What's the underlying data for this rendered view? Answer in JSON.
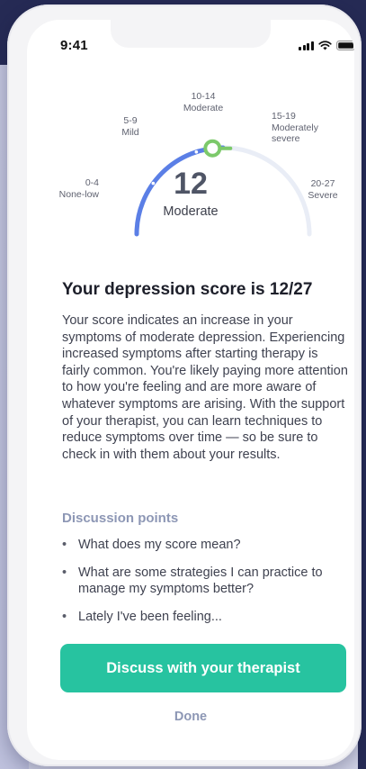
{
  "status_bar": {
    "time": "9:41"
  },
  "gauge": {
    "score": "12",
    "level": "Moderate",
    "ranges": [
      {
        "range": "0-4",
        "label": "None-low"
      },
      {
        "range": "5-9",
        "label": "Mild"
      },
      {
        "range": "10-14",
        "label": "Moderate"
      },
      {
        "range": "15-19",
        "label": "Moderately severe"
      },
      {
        "range": "20-27",
        "label": "Severe"
      }
    ],
    "score_value": 12,
    "score_max": 27,
    "colors": {
      "active": "#5b7fe6",
      "track": "#e9edf6",
      "marker": "#7cc96a"
    }
  },
  "result": {
    "title": "Your depression score is 12/27",
    "body": "Your score indicates an increase in your symptoms of moderate depression. Experiencing increased symptoms after starting therapy is fairly common. You're likely paying more attention to how you're feeling and are more aware of whatever symptoms are arising. With the support of your therapist, you can learn techniques to reduce symptoms over time — so be sure to check in with them about your results."
  },
  "discussion": {
    "heading": "Discussion points",
    "items": [
      "What does my score mean?",
      "What are some strategies I can practice to manage my symptoms better?",
      "Lately I've been feeling..."
    ]
  },
  "actions": {
    "primary_label": "Discuss with your therapist",
    "secondary_label": "Done",
    "accent": "#27c3a0"
  }
}
